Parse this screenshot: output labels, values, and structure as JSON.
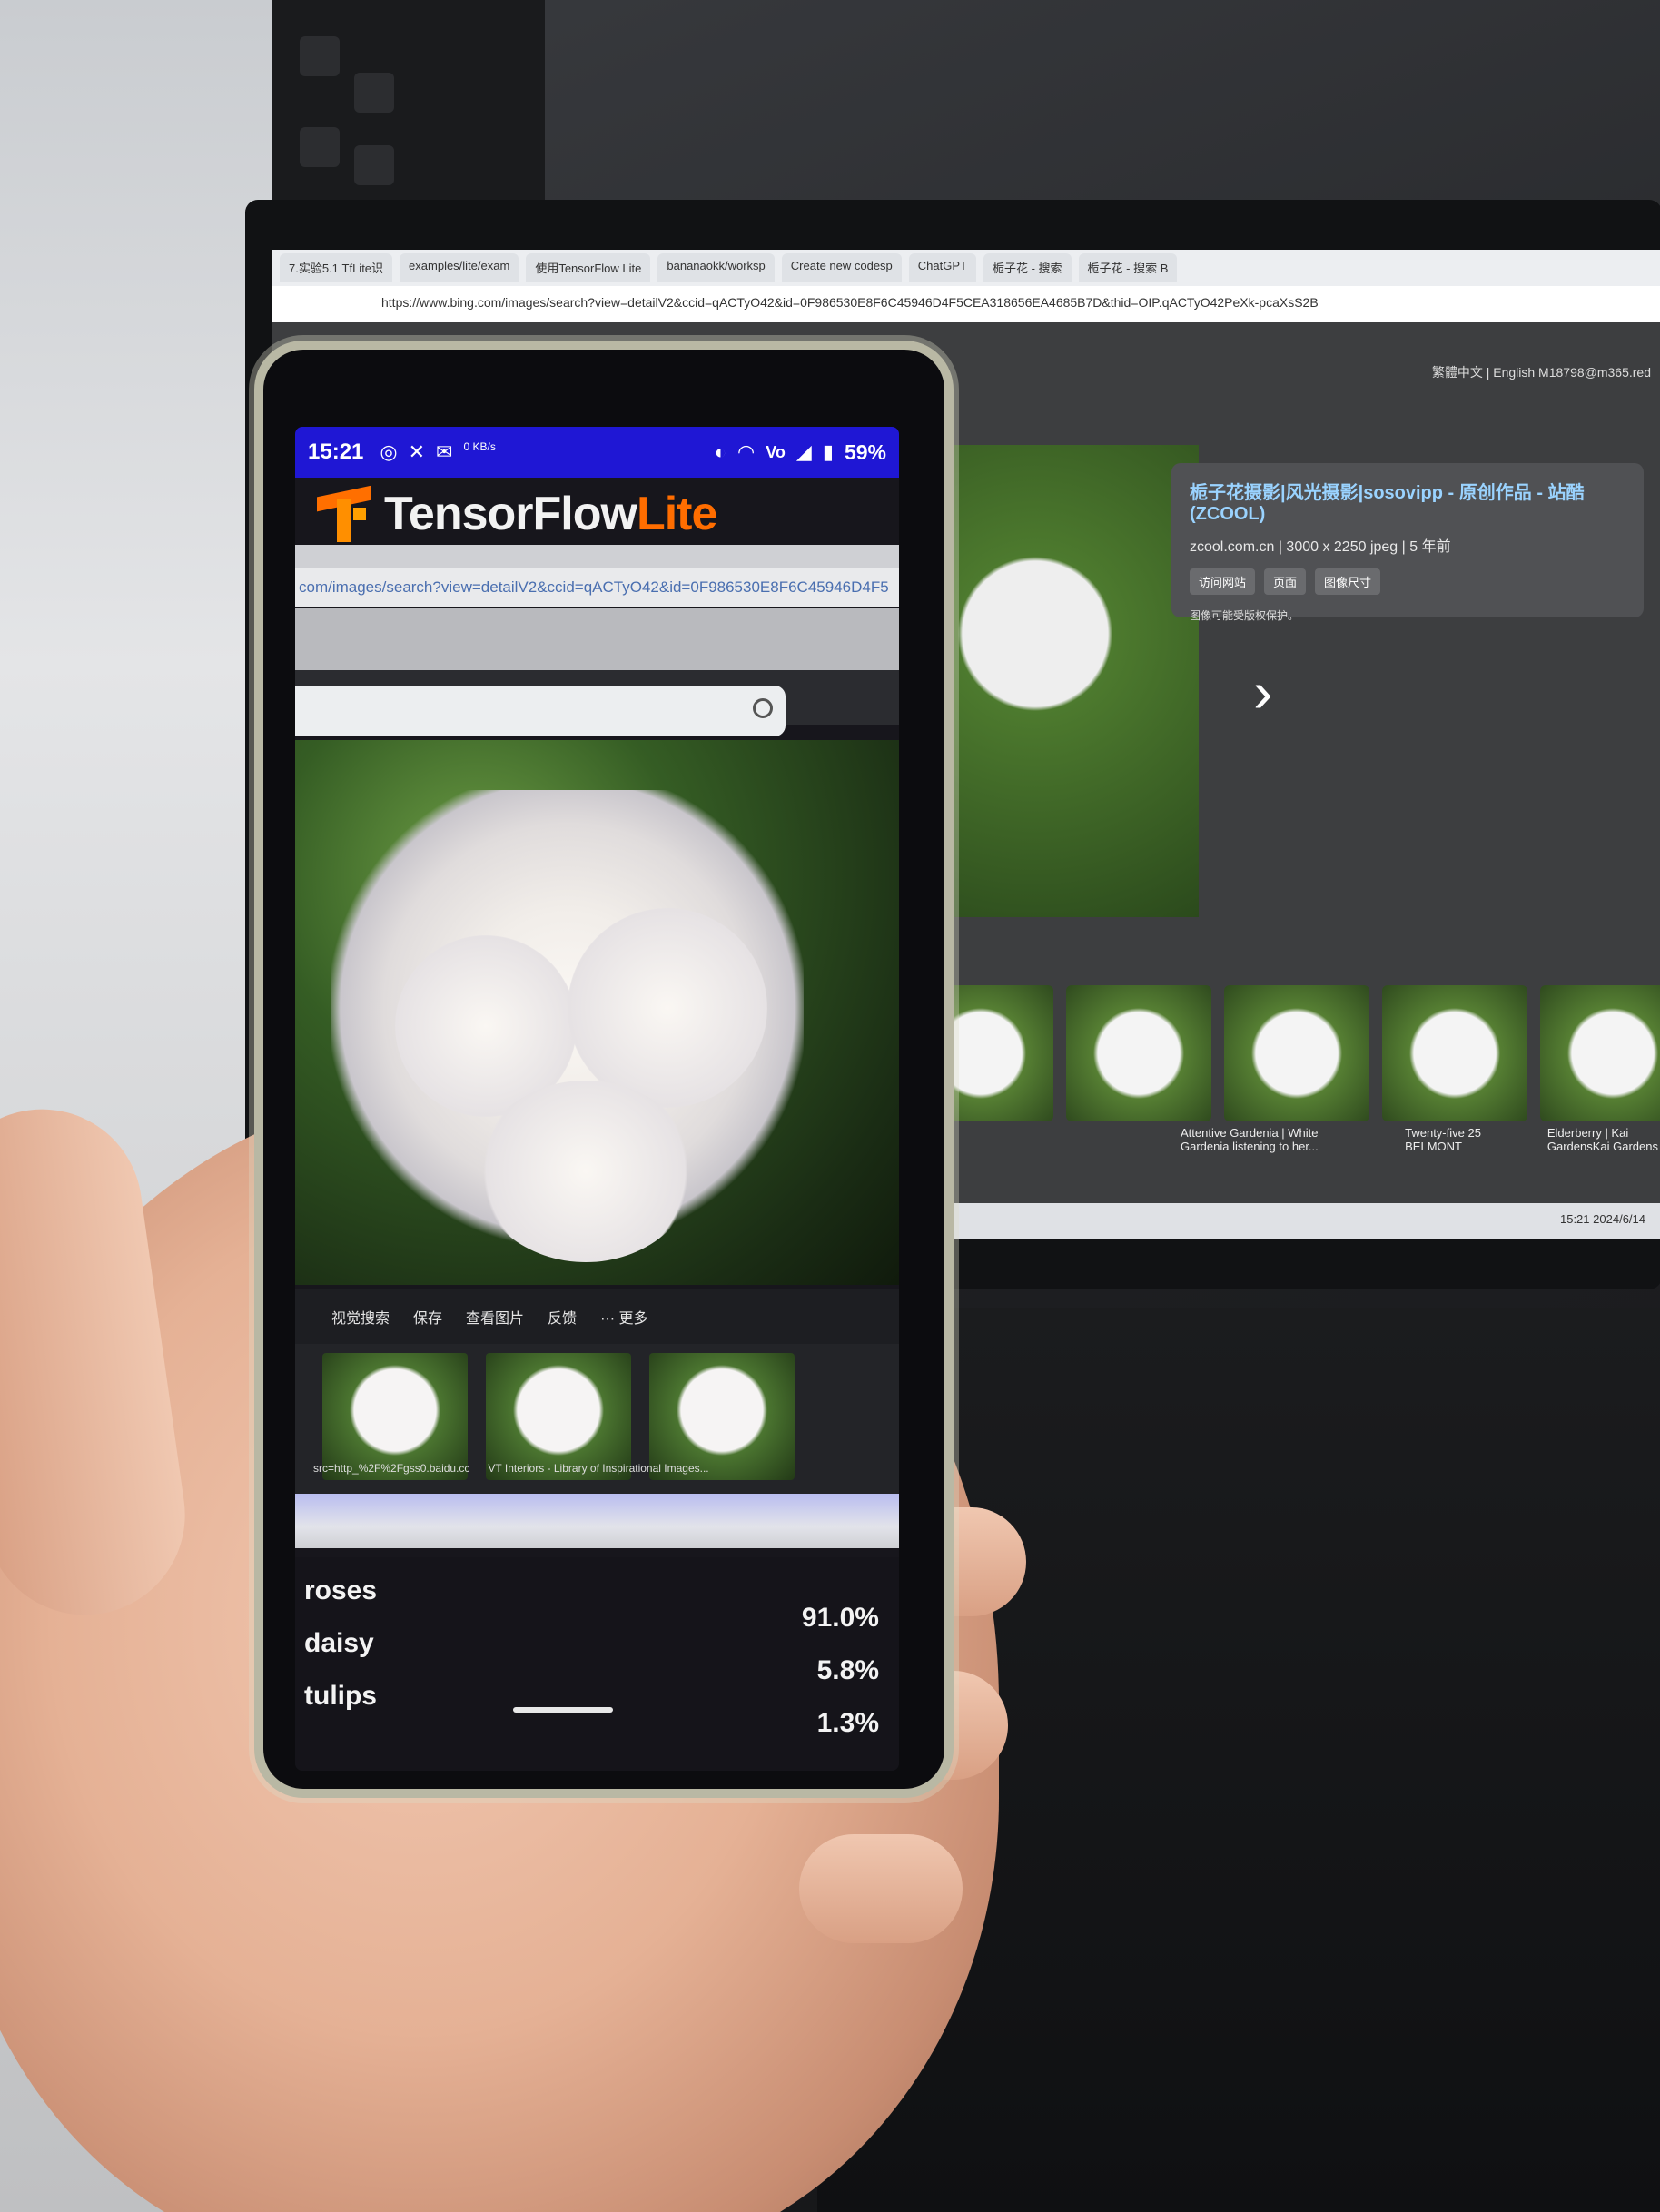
{
  "background": {
    "browser_tabs": [
      "7.实验5.1 TfLite识",
      "examples/lite/exam",
      "使用TensorFlow Lite",
      "bananaokk/worksp",
      "Create new codesp",
      "ChatGPT",
      "栀子花 - 搜索",
      "栀子花 - 搜索 B"
    ],
    "address_url": "https://www.bing.com/images/search?view=detailV2&ccid=qACTyO42&id=0F986530E8F6C45946D4F5CEA318656EA4685B7D&thid=OIP.qACTyO42PeXk-pcaXsS2B",
    "top_links": "繁體中文 | English   M18798@m365.red",
    "panel": {
      "title": "栀子花摄影|风光摄影|sosovipp - 原创作品 - 站酷 (ZCOOL)",
      "meta": "zcool.com.cn | 3000 x 2250 jpeg | 5 年前",
      "buttons": [
        "访问网站",
        "页面",
        "图像尺寸"
      ],
      "note": "图像可能受版权保护。"
    },
    "thumb_captions": [
      "Attentive Gardenia | White Gardenia listening to her...",
      "Twenty-five 25 BELMONT",
      "Elderberry | Kai GardensKai Gardens"
    ],
    "taskbar_time": "15:21",
    "taskbar_date": "2024/6/14"
  },
  "phone": {
    "status_bar": {
      "time": "15:21",
      "battery": "59%",
      "net_speed": "0 KB/s"
    },
    "app": {
      "brand_main": "TensorFlow",
      "brand_suffix": "Lite"
    },
    "camera_view": {
      "url_text": "com/images/search?view=detailV2&ccid=qACTyO42&id=0F986530E8F6C45946D4F5",
      "toolbar": [
        "视觉搜索",
        "保存",
        "查看图片",
        "反馈",
        "··· 更多"
      ],
      "thumb_captions": [
        "src=http_%2F%2Fgss0.baidu.cc",
        "VT Interiors - Library of Inspirational Images...",
        ""
      ]
    },
    "results": [
      {
        "label": "roses",
        "score": "91.0%"
      },
      {
        "label": "daisy",
        "score": "5.8%"
      },
      {
        "label": "tulips",
        "score": "1.3%"
      }
    ]
  }
}
